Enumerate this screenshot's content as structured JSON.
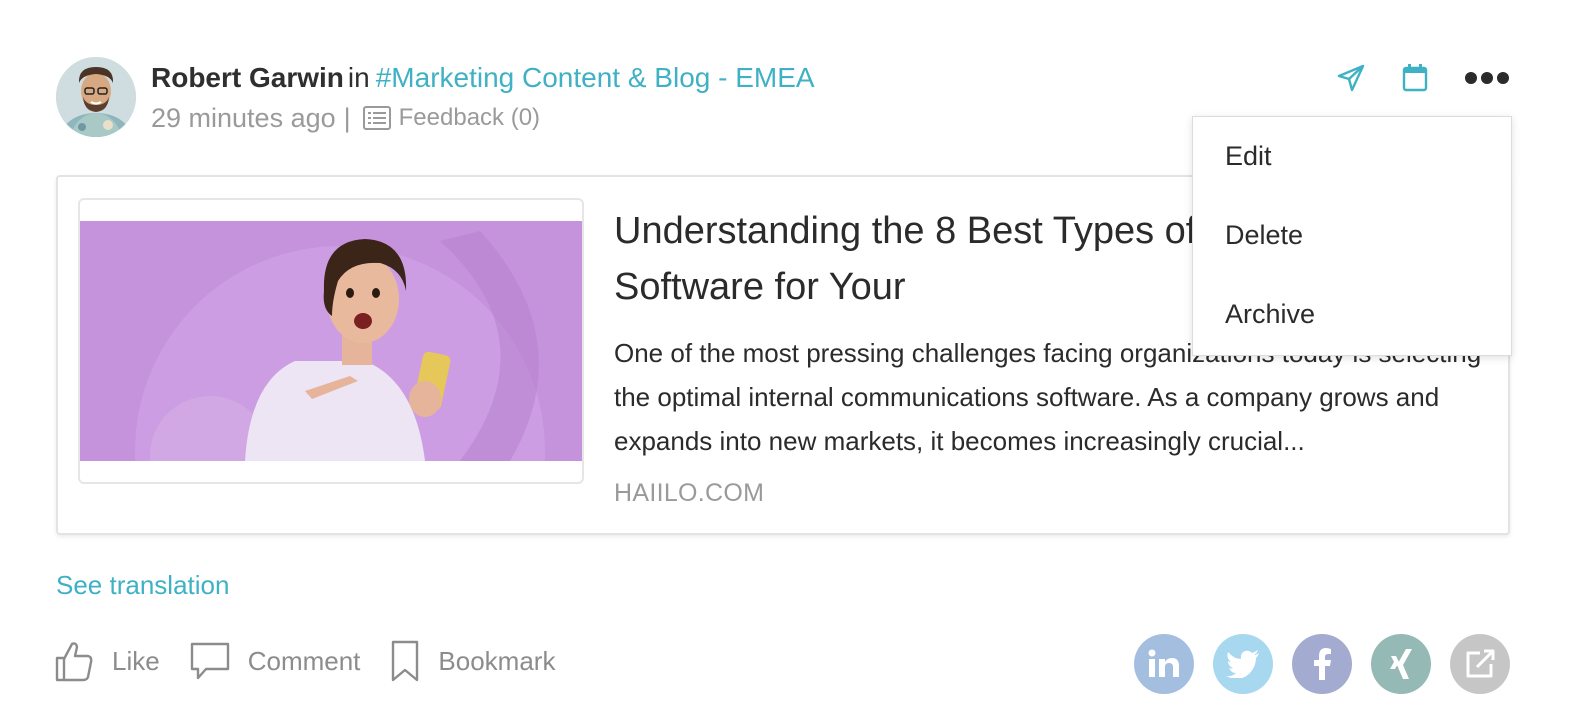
{
  "post": {
    "author": "Robert Garwin",
    "in_word": "in",
    "channel": "#Marketing Content & Blog - EMEA",
    "time": "29 minutes ago",
    "separator": "|",
    "feedback": "Feedback (0)"
  },
  "card": {
    "title": "Understanding the 8 Best Types of Communication Software for Your",
    "excerpt": "One of the most pressing challenges facing organizations today is selecting the optimal internal communications software. As a company grows and expands into new markets, it becomes increasingly crucial...",
    "source": "HAIILO.COM"
  },
  "menu": {
    "items": [
      "Edit",
      "Delete",
      "Archive"
    ]
  },
  "see_translation": "See translation",
  "actions": {
    "like": "Like",
    "comment": "Comment",
    "bookmark": "Bookmark"
  },
  "share": {
    "linkedin_color": "#a3bedf",
    "twitter_color": "#a8d8f0",
    "facebook_color": "#a3abd0",
    "xing_color": "#95b9b5",
    "external_color": "#c6c6c6",
    "icons": [
      "linkedin-icon",
      "twitter-icon",
      "facebook-icon",
      "xing-icon",
      "external-share-icon"
    ]
  },
  "colors": {
    "accent": "#3fb1c5",
    "thumb_bg": "#c592dc"
  }
}
